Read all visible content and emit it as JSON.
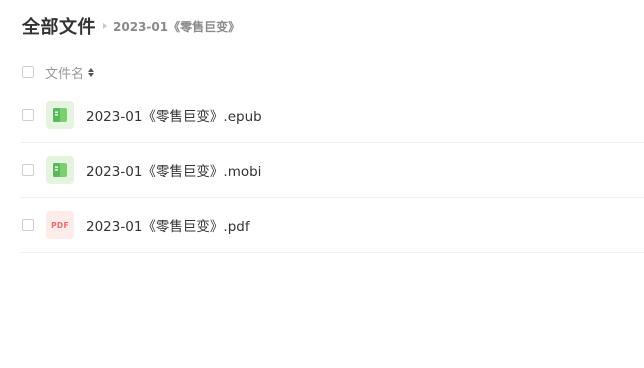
{
  "breadcrumb": {
    "root": "全部文件",
    "current": "2023-01《零售巨变》"
  },
  "list_header": {
    "name_label": "文件名"
  },
  "files": [
    {
      "name": "2023-01《零售巨变》.epub",
      "icon": "ebook-icon"
    },
    {
      "name": "2023-01《零售巨变》.mobi",
      "icon": "ebook-icon"
    },
    {
      "name": "2023-01《零售巨变》.pdf",
      "icon": "pdf-icon",
      "icon_text": "PDF"
    }
  ],
  "colors": {
    "ebook_icon_bg": "#e4f4de",
    "ebook_icon_fg": "#5cb85c",
    "pdf_icon_bg": "#fdecea",
    "pdf_icon_fg": "#ef6a6a"
  }
}
